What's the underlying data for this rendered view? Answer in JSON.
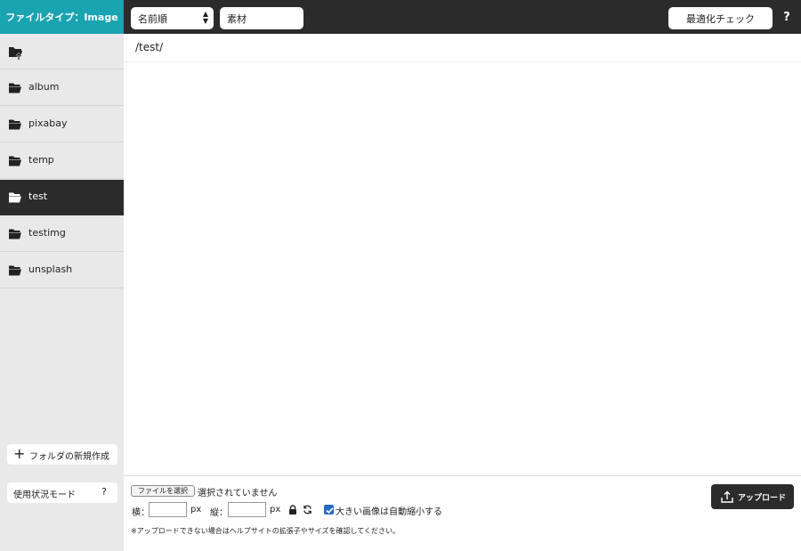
{
  "header": {
    "file_type_label": "ファイルタイプ：Image",
    "sort": {
      "selected": "名前順"
    },
    "search": {
      "value": "素材",
      "placeholder": ""
    },
    "optimize_button": "最適化チェック",
    "help": "?"
  },
  "sidebar": {
    "items": [
      {
        "label": "album",
        "icon": "folder-open-icon",
        "active": false
      },
      {
        "label": "pixabay",
        "icon": "folder-open-icon",
        "active": false
      },
      {
        "label": "temp",
        "icon": "folder-open-icon",
        "active": false
      },
      {
        "label": "test",
        "icon": "folder-open-icon",
        "active": true
      },
      {
        "label": "testimg",
        "icon": "folder-open-icon",
        "active": false
      },
      {
        "label": "unsplash",
        "icon": "folder-open-icon",
        "active": false
      }
    ],
    "new_folder_button": "フォルダの新規作成",
    "usage_button": "使用状況モード",
    "usage_help": "?"
  },
  "main": {
    "path": "/test/"
  },
  "footer": {
    "file_choose_button": "ファイルを選択",
    "no_file_text": "選択されていません",
    "width_label": "横：",
    "width_value": "",
    "height_label": "縦：",
    "height_value": "",
    "unit": "px",
    "auto_shrink_checked": true,
    "auto_shrink_label": "大きい画像は自動縮小する",
    "note": "※アップロードできない場合はヘルプサイトの拡張子やサイズを確認してください。",
    "upload_button": "アップロード"
  },
  "colors": {
    "accent": "#1aa3b1",
    "dark": "#2b2b2b",
    "sidebar_bg": "#e9e9e9",
    "checkbox": "#2a6ac7"
  }
}
